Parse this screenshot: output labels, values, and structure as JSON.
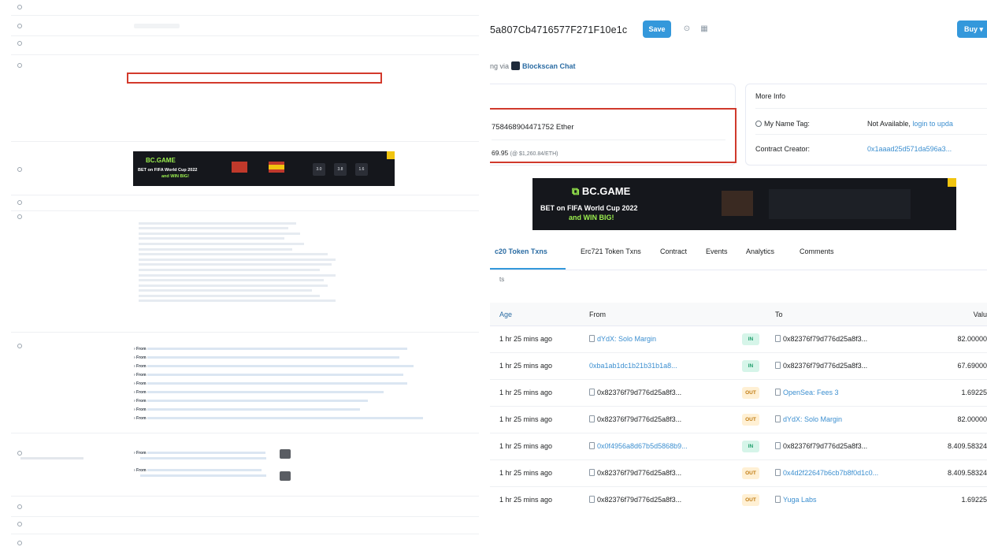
{
  "left": {
    "ad": {
      "logo": "BC.GAME",
      "line1": "BET on FIFA World Cup 2022",
      "line2": "and WIN BIG!",
      "box_a": "3.0",
      "box_b": "3.8",
      "box_c": "1.6"
    }
  },
  "right": {
    "address": "5a807Cb4716577F271F10e1c",
    "save_label": "Save",
    "buy_label": "Buy",
    "trading_prefix": "ng via",
    "trading_link": "Blockscan Chat",
    "balance_line": "758468904471752 Ether",
    "value_prefix": "69.95",
    "value_suffix": "(@ $1,260.84/ETH)",
    "more_info": {
      "title": "More Info",
      "name_tag_label": "My Name Tag:",
      "name_tag_value": "Not Available,",
      "name_tag_link": "login to upda",
      "creator_label": "Contract Creator:",
      "creator_value": "0x1aaad25d571da596a3..."
    },
    "ad": {
      "logo": "BC.GAME",
      "line1": "BET on FIFA World Cup 2022",
      "line2": "and WIN BIG!"
    },
    "tabs": [
      "c20 Token Txns",
      "Erc721 Token Txns",
      "Contract",
      "Events",
      "Analytics",
      "Comments"
    ],
    "sub_info": "ts",
    "columns": {
      "age": "Age",
      "from": "From",
      "to": "To",
      "value": "Valu"
    },
    "rows": [
      {
        "age": "1 hr 25 mins ago",
        "from": "dYdX: Solo Margin",
        "dir": "IN",
        "to": "0x82376f79d776d25a8f3...",
        "value": "82.00000"
      },
      {
        "age": "1 hr 25 mins ago",
        "from": "0xba1ab1dc1b21b31b1a8...",
        "dir": "IN",
        "to": "0x82376f79d776d25a8f3...",
        "value": "67.69000"
      },
      {
        "age": "1 hr 25 mins ago",
        "from": "0x82376f79d776d25a8f3...",
        "dir": "OUT",
        "to": "OpenSea: Fees 3",
        "value": "1.69225"
      },
      {
        "age": "1 hr 25 mins ago",
        "from": "0x82376f79d776d25a8f3...",
        "dir": "OUT",
        "to": "dYdX: Solo Margin",
        "value": "82.00000"
      },
      {
        "age": "1 hr 25 mins ago",
        "from": "0x0f4956a8d67b5d5868b9...",
        "dir": "IN",
        "to": "0x82376f79d776d25a8f3...",
        "value": "8.409.58324"
      },
      {
        "age": "1 hr 25 mins ago",
        "from": "0x82376f79d776d25a8f3...",
        "dir": "OUT",
        "to": "0x4d2f22647b6cb7b8f0d1c0...",
        "value": "8.409.58324"
      },
      {
        "age": "1 hr 25 mins ago",
        "from": "0x82376f79d776d25a8f3...",
        "dir": "OUT",
        "to": "Yuga Labs",
        "value": "1.69225"
      }
    ]
  }
}
